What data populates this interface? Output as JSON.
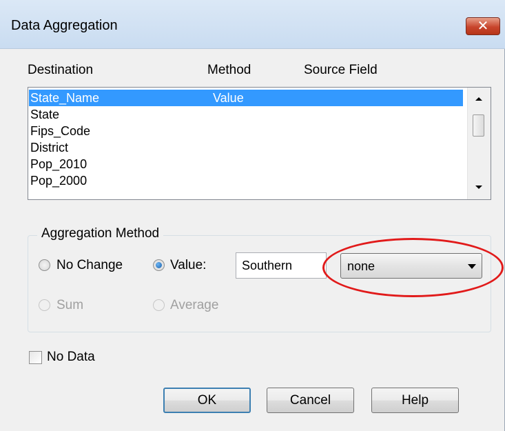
{
  "window": {
    "title": "Data Aggregation",
    "close_glyph": "✕"
  },
  "columns": {
    "destination": "Destination",
    "method": "Method",
    "source_field": "Source Field"
  },
  "list": {
    "rows": [
      {
        "destination": "State_Name",
        "method": "Value",
        "source": "",
        "selected": true
      },
      {
        "destination": "State",
        "method": "",
        "source": "",
        "selected": false
      },
      {
        "destination": "Fips_Code",
        "method": "",
        "source": "",
        "selected": false
      },
      {
        "destination": "District",
        "method": "",
        "source": "",
        "selected": false
      },
      {
        "destination": "Pop_2010",
        "method": "",
        "source": "",
        "selected": false
      },
      {
        "destination": "Pop_2000",
        "method": "",
        "source": "",
        "selected": false
      }
    ]
  },
  "aggregation": {
    "legend": "Aggregation Method",
    "no_change_label": "No Change",
    "value_label": "Value:",
    "value_text": "Southern",
    "source_select": "none",
    "sum_label": "Sum",
    "average_label": "Average",
    "selected_method": "Value"
  },
  "no_data": {
    "label": "No Data",
    "checked": false
  },
  "buttons": {
    "ok": "OK",
    "cancel": "Cancel",
    "help": "Help"
  },
  "colors": {
    "selection": "#3399ff",
    "highlight_ring": "#e11a1a"
  }
}
